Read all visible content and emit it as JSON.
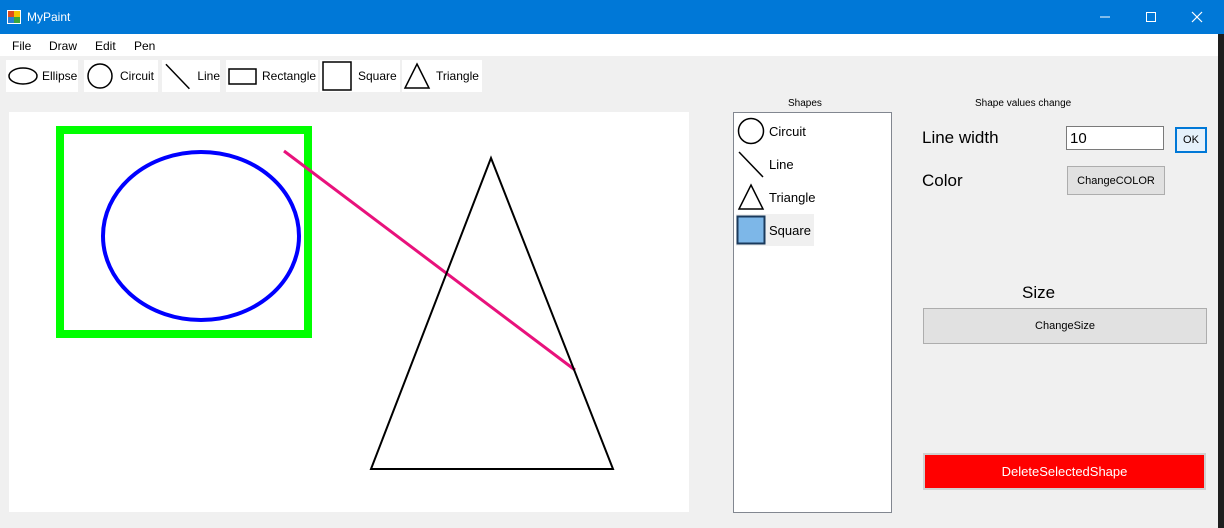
{
  "window": {
    "title": "MyPaint",
    "icon": "paint-app-icon"
  },
  "menu": [
    "File",
    "Draw",
    "Edit",
    "Pen"
  ],
  "toolbar": {
    "tools": [
      {
        "label": "Ellipse",
        "icon": "ellipse-icon"
      },
      {
        "label": "Circuit",
        "icon": "circle-icon"
      },
      {
        "label": "Line",
        "icon": "line-icon"
      },
      {
        "label": "Rectangle",
        "icon": "rectangle-icon"
      },
      {
        "label": "Square",
        "icon": "square-icon"
      },
      {
        "label": "Triangle",
        "icon": "triangle-icon"
      }
    ]
  },
  "canvas": {
    "shapes": [
      {
        "type": "square",
        "color": "#00ff00"
      },
      {
        "type": "ellipse",
        "color": "#0000ff"
      },
      {
        "type": "line",
        "color": "#e8127c"
      },
      {
        "type": "triangle",
        "color": "#000000"
      }
    ]
  },
  "shapes_panel": {
    "caption": "Shapes",
    "items": [
      {
        "label": "Circuit",
        "icon": "circle-icon"
      },
      {
        "label": "Line",
        "icon": "line-icon"
      },
      {
        "label": "Triangle",
        "icon": "triangle-icon"
      },
      {
        "label": "Square",
        "icon": "square-icon",
        "selected": true
      }
    ]
  },
  "values_panel": {
    "caption": "Shape values change",
    "line_width_label": "Line width",
    "line_width_value": "10",
    "ok_label": "OK",
    "color_label": "Color",
    "change_color_label": "ChangeCOLOR",
    "size_label": "Size",
    "change_size_label": "ChangeSize",
    "delete_label": "DeleteSelectedShape",
    "delete_color": "#ff0000"
  },
  "colors": {
    "titlebar": "#0078d7",
    "selection": "#7db7e8"
  }
}
